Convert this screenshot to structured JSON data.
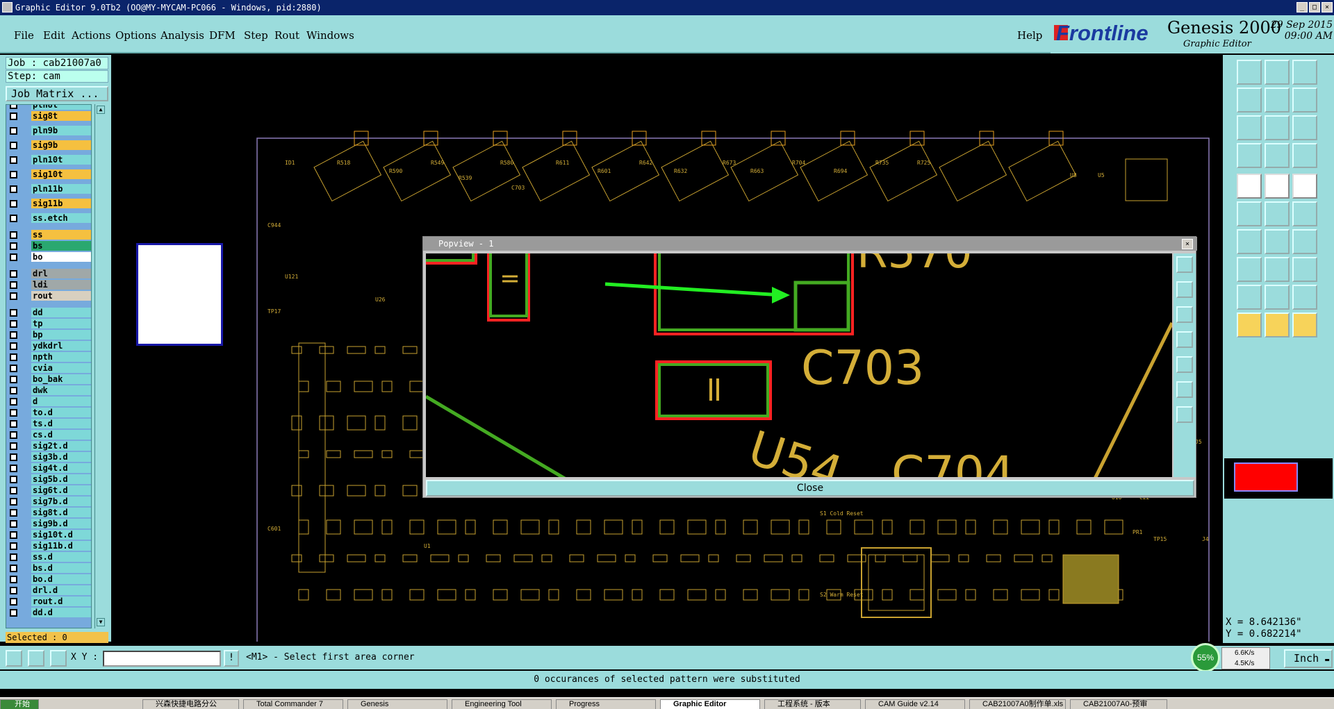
{
  "window": {
    "title": "Graphic Editor 9.0Tb2 (OO@MY-MYCAM-PC066 - Windows, pid:2880)"
  },
  "menu": {
    "items": [
      "File",
      "Edit",
      "Actions",
      "Options",
      "Analysis",
      "DFM",
      "Step",
      "Rout",
      "Windows"
    ],
    "help": "Help"
  },
  "brand": {
    "logo": "Frontline",
    "product": "Genesis 2000",
    "subtitle": "Graphic Editor",
    "date": "29 Sep 2015",
    "time": "09:00 AM"
  },
  "job": {
    "job_label": "Job : cab21007a0",
    "step_label": "Step: cam",
    "matrix_button": "Job Matrix ..."
  },
  "layers": [
    {
      "name": "pln8t",
      "color": "#7ed8d8"
    },
    {
      "name": "sig8t",
      "color": "#f5c040"
    },
    {
      "name": "pln9b",
      "color": "#7ed8d8"
    },
    {
      "name": "sig9b",
      "color": "#f5c040"
    },
    {
      "name": "pln10t",
      "color": "#7ed8d8"
    },
    {
      "name": "sig10t",
      "color": "#f5c040"
    },
    {
      "name": "pln11b",
      "color": "#7ed8d8"
    },
    {
      "name": "sig11b",
      "color": "#f5c040"
    },
    {
      "name": "ss.etch",
      "color": "#7ed8d8"
    },
    {
      "name": "ss",
      "color": "#f5c040"
    },
    {
      "name": "bs",
      "color": "#2aa870"
    },
    {
      "name": "bo",
      "color": "#ffffff"
    },
    {
      "name": "drl",
      "color": "#a0a8a8"
    },
    {
      "name": "ldi",
      "color": "#a0a8a8"
    },
    {
      "name": "rout",
      "color": "#d8d0c0"
    },
    {
      "name": "dd",
      "color": "#7ed8d8"
    },
    {
      "name": "tp",
      "color": "#7ed8d8"
    },
    {
      "name": "bp",
      "color": "#7ed8d8"
    },
    {
      "name": "ydkdrl",
      "color": "#7ed8d8"
    },
    {
      "name": "npth",
      "color": "#7ed8d8"
    },
    {
      "name": "cvia",
      "color": "#7ed8d8"
    },
    {
      "name": "bo_bak",
      "color": "#7ed8d8"
    },
    {
      "name": "dwk",
      "color": "#7ed8d8"
    },
    {
      "name": "d",
      "color": "#7ed8d8"
    },
    {
      "name": "to.d",
      "color": "#7ed8d8"
    },
    {
      "name": "ts.d",
      "color": "#7ed8d8"
    },
    {
      "name": "cs.d",
      "color": "#7ed8d8"
    },
    {
      "name": "sig2t.d",
      "color": "#7ed8d8"
    },
    {
      "name": "sig3b.d",
      "color": "#7ed8d8"
    },
    {
      "name": "sig4t.d",
      "color": "#7ed8d8"
    },
    {
      "name": "sig5b.d",
      "color": "#7ed8d8"
    },
    {
      "name": "sig6t.d",
      "color": "#7ed8d8"
    },
    {
      "name": "sig7b.d",
      "color": "#7ed8d8"
    },
    {
      "name": "sig8t.d",
      "color": "#7ed8d8"
    },
    {
      "name": "sig9b.d",
      "color": "#7ed8d8"
    },
    {
      "name": "sig10t.d",
      "color": "#7ed8d8"
    },
    {
      "name": "sig11b.d",
      "color": "#7ed8d8"
    },
    {
      "name": "ss.d",
      "color": "#7ed8d8"
    },
    {
      "name": "bs.d",
      "color": "#7ed8d8"
    },
    {
      "name": "bo.d",
      "color": "#7ed8d8"
    },
    {
      "name": "drl.d",
      "color": "#7ed8d8"
    },
    {
      "name": "rout.d",
      "color": "#7ed8d8"
    },
    {
      "name": "dd.d",
      "color": "#7ed8d8"
    }
  ],
  "selected": "Selected : 0",
  "popview": {
    "title": "Popview - 1",
    "close_label": "Close",
    "labels": [
      "R570",
      "C703",
      "U54",
      "C704"
    ]
  },
  "canvas_labels": [
    "ID1",
    "R518",
    "R590",
    "R549",
    "R539",
    "R580",
    "C703",
    "R611",
    "R601",
    "R642",
    "R632",
    "R673",
    "R663",
    "R704",
    "R694",
    "R735",
    "R725",
    "U8",
    "U5",
    "C944",
    "U121",
    "U26",
    "TP17",
    "C601",
    "U1",
    "U19",
    "U25",
    "S1 Cold Reset",
    "S2 Warm Reset",
    "J4",
    "J5",
    "C16",
    "C22",
    "U10",
    "TP15",
    "PR1"
  ],
  "coords": {
    "x": "X = 8.642136\"",
    "y": "Y = 0.682214\""
  },
  "command": {
    "xy_label": "X Y :",
    "xy_value": "",
    "prompt": "<M1> - Select first area corner"
  },
  "status": "0 occurances of selected pattern were substituted",
  "units": "Inch",
  "net": {
    "percent": "55%",
    "up": "6.6K/s",
    "down": "4.5K/s"
  },
  "taskbar": {
    "start": "开始",
    "tasks": [
      "兴森快捷电路分公",
      "Total Commander 7",
      "Genesis",
      "Engineering Tool",
      "Progress",
      "Graphic Editor",
      "工程系统 - 版本",
      "CAM Guide v2.14",
      "CAB21007A0制作单.xls",
      "CAB21007A0-预审"
    ]
  },
  "colors": {
    "panel": "#9bdcdc",
    "signal": "#f5c040",
    "pad_red": "#ff2020",
    "pad_green": "#40c020",
    "arrow": "#22ee22"
  }
}
